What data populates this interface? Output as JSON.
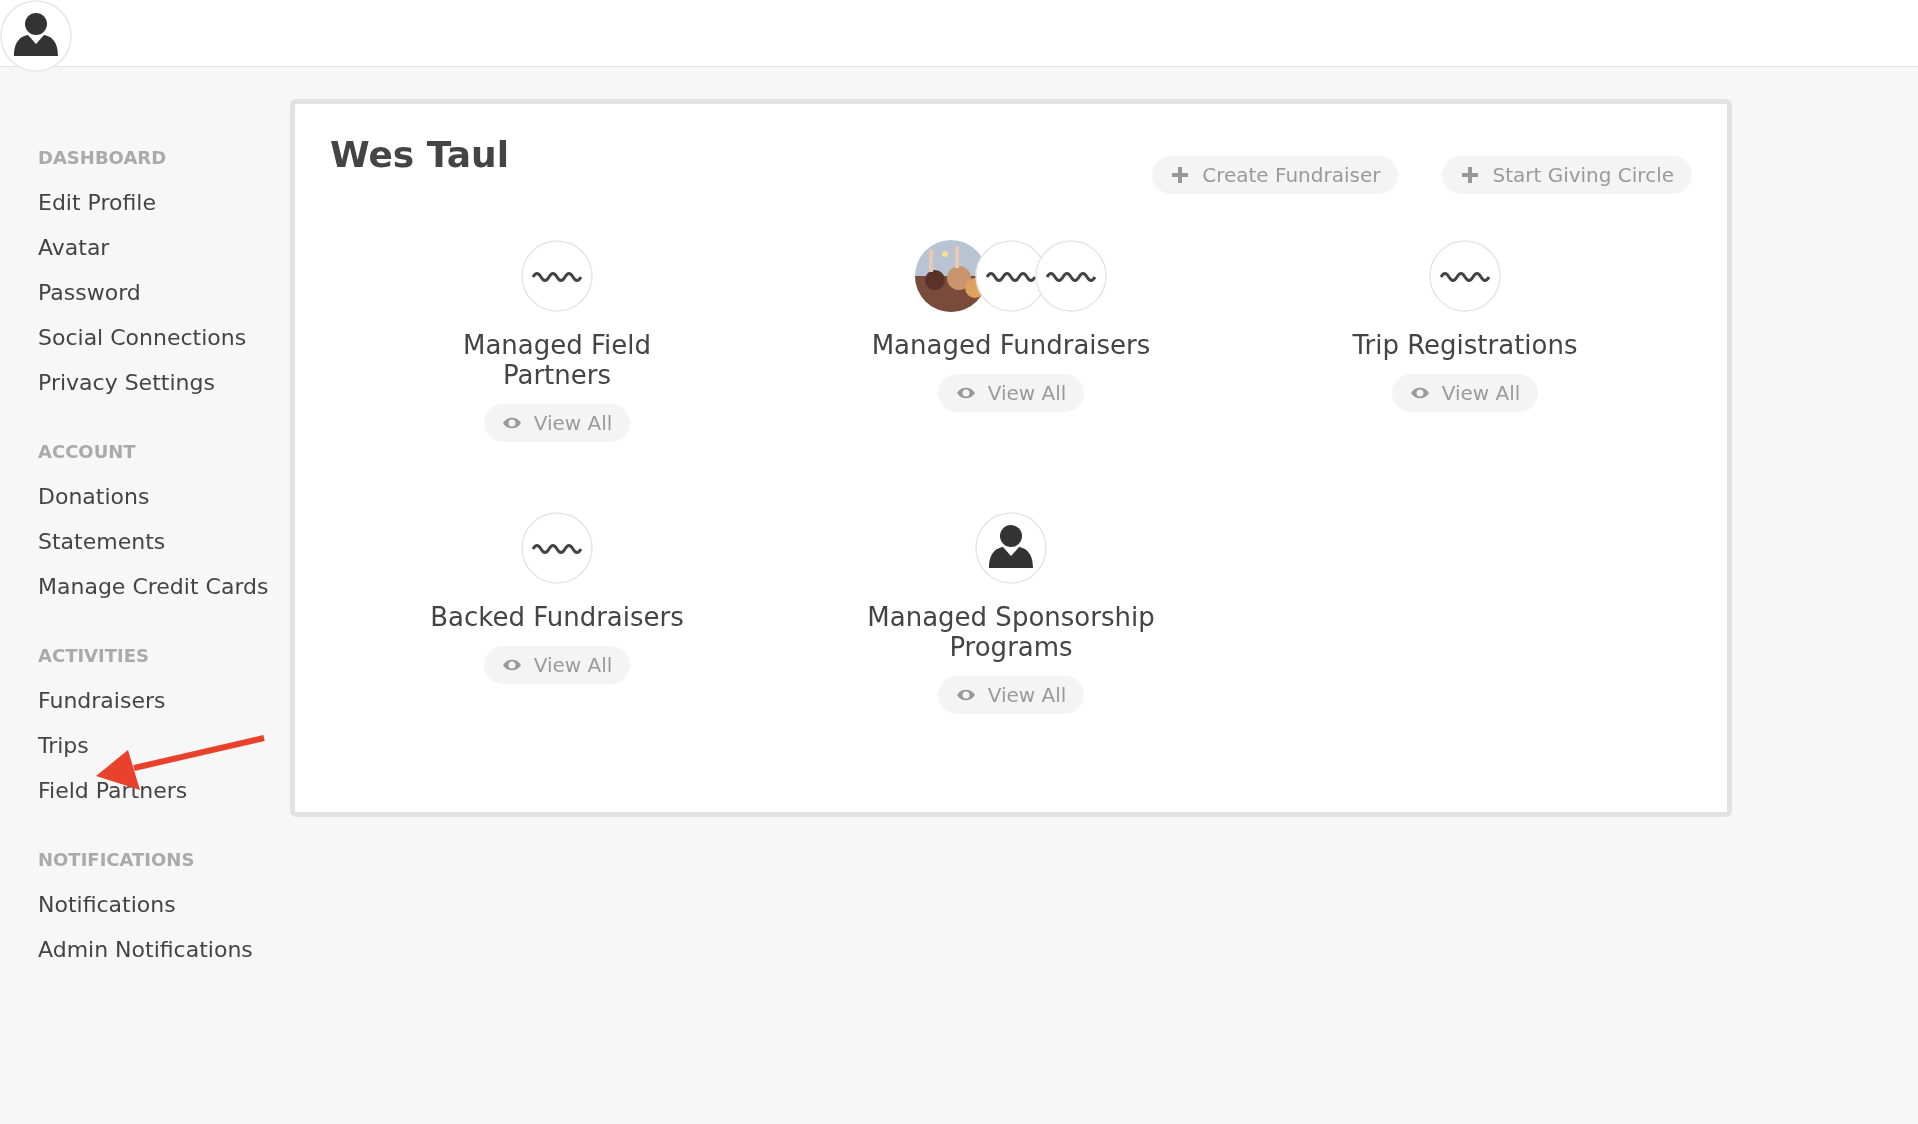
{
  "profile": {
    "name": "Wes Taul"
  },
  "sidebar": [
    {
      "heading": "DASHBOARD",
      "items": [
        "Edit Profile",
        "Avatar",
        "Password",
        "Social Connections",
        "Privacy Settings"
      ]
    },
    {
      "heading": "ACCOUNT",
      "items": [
        "Donations",
        "Statements",
        "Manage Credit Cards"
      ]
    },
    {
      "heading": "ACTIVITIES",
      "items": [
        "Fundraisers",
        "Trips",
        "Field Partners"
      ]
    },
    {
      "heading": "NOTIFICATIONS",
      "items": [
        "Notifications",
        "Admin Notifications"
      ]
    }
  ],
  "actions": [
    "Create Fundraiser",
    "Start Giving Circle"
  ],
  "sections": [
    {
      "title": "Managed Field Partners",
      "button": "View All",
      "images": [
        {
          "kind": "logo"
        }
      ]
    },
    {
      "title": "Managed Fundraisers",
      "button": "View All",
      "images": [
        {
          "kind": "picture"
        },
        {
          "kind": "logo"
        },
        {
          "kind": "logo"
        }
      ]
    },
    {
      "title": "Trip Registrations",
      "button": "View All",
      "images": [
        {
          "kind": "logo"
        }
      ]
    },
    {
      "title": "Backed Fundraisers",
      "button": "View All",
      "images": [
        {
          "kind": "logo"
        }
      ]
    },
    {
      "title": "Managed Sponsorship Programs",
      "button": "View All",
      "images": [
        {
          "kind": "person"
        }
      ]
    }
  ]
}
